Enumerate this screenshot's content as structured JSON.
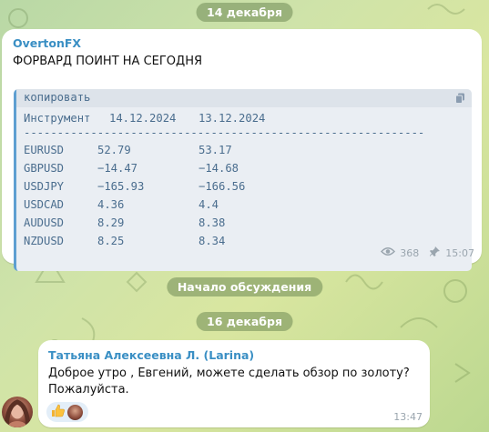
{
  "date_separators": [
    "14 декабря",
    "16 декабря"
  ],
  "discussion_label": "Начало обсуждения",
  "post": {
    "sender": "OvertonFX",
    "text": "ФОРВАРД ПОИНТ НА СЕГОДНЯ",
    "code_copy_label": "копировать",
    "table_header": [
      "Инструмент",
      "14.12.2024",
      "13.12.2024"
    ],
    "divider": "------------------------------------------------------------",
    "rows": [
      [
        "EURUSD",
        "52.79",
        "53.17"
      ],
      [
        "GBPUSD",
        "−14.47",
        "−14.68"
      ],
      [
        "USDJPY",
        "−165.93",
        "−166.56"
      ],
      [
        "USDCAD",
        "4.36",
        "4.4"
      ],
      [
        "AUDUSD",
        "8.29",
        "8.38"
      ],
      [
        "NZDUSD",
        "8.25",
        "8.34"
      ]
    ],
    "views": "368",
    "time": "15:07"
  },
  "comment": {
    "sender": "Татьяна Алексеевна Л. (Larina)",
    "line1": "Доброе утро , Евгений, можете сделать обзор по золоту?",
    "line2": "Пожалуйста.",
    "time": "13:47",
    "reaction_icon": "thumbs-up"
  },
  "colors": {
    "sender": "#3a8fc4",
    "code_text": "#4a6d8e",
    "code_border": "#5e9fd1"
  }
}
